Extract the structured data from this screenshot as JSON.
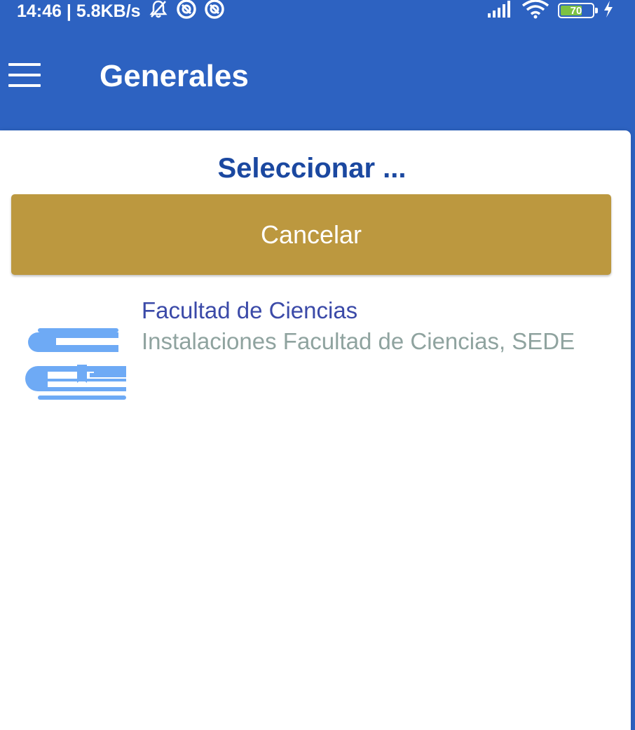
{
  "status_bar": {
    "time_speed": "14:46 | 5.8KB/s",
    "battery_level": "70",
    "battery_fraction": 0.7,
    "icons": [
      "notifications-off-icon",
      "vpn-icon",
      "vpn-icon",
      "signal-icon",
      "wifi-icon",
      "battery-icon",
      "charging-icon"
    ]
  },
  "app_bar": {
    "title": "Generales",
    "menu_icon": "hamburger-menu-icon"
  },
  "dialog": {
    "title": "Seleccionar ...",
    "cancel_label": "Cancelar",
    "items": [
      {
        "title": "Facultad de Ciencias",
        "subtitle": "Instalaciones Facultad de Ciencias, SEDE",
        "icon": "books-icon"
      }
    ]
  },
  "colors": {
    "primary": "#2d62c1",
    "dialog_title": "#1b48a0",
    "cancel_button": "#bc983f",
    "item_title": "#3b4aa8",
    "item_subtitle": "#8fa39f",
    "item_icon": "#6eaaf5"
  }
}
